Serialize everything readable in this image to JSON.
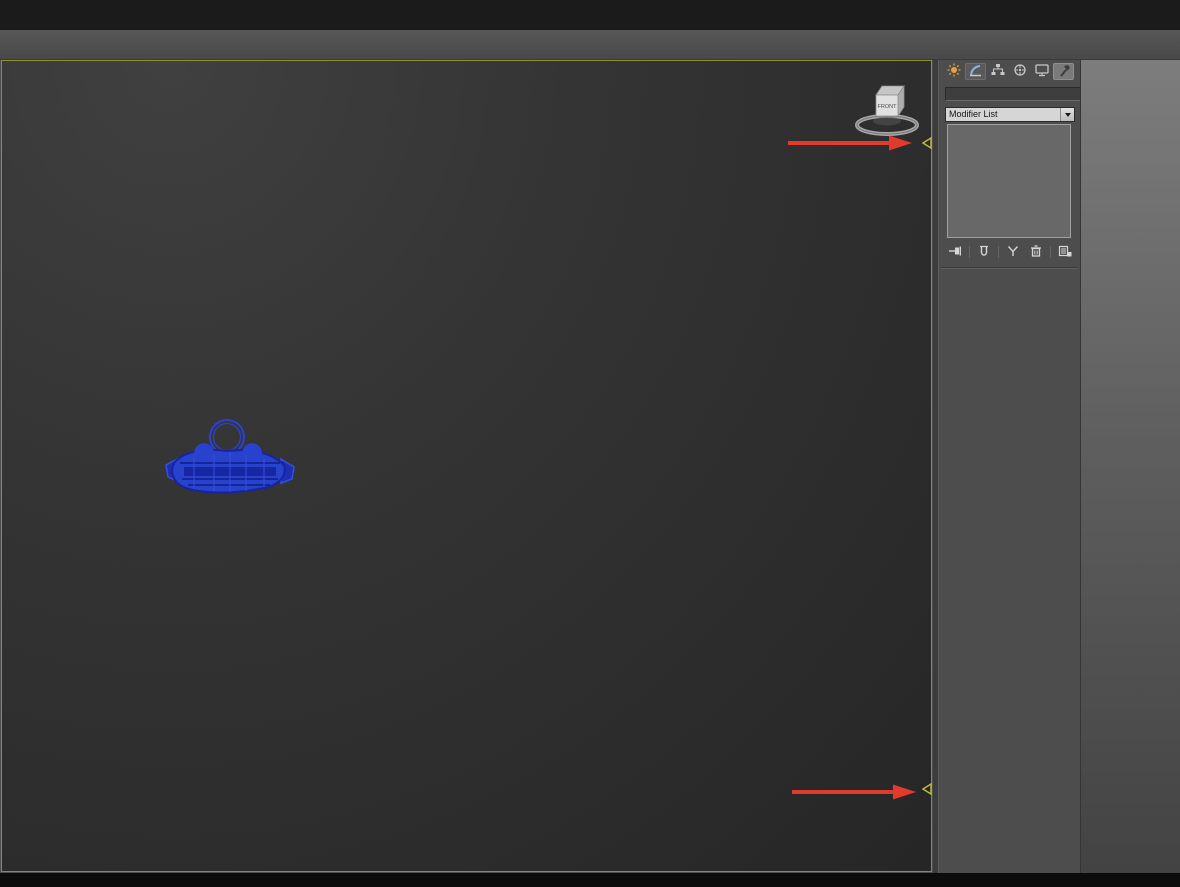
{
  "viewport": {
    "viewcube_label": "FRONT",
    "active_border_color": "#8f8f2f",
    "object_color": "#2742cc",
    "edge_marker_color": "#b9b93f"
  },
  "command_panel": {
    "tabs": [
      {
        "id": "create",
        "label": "Create"
      },
      {
        "id": "modify",
        "label": "Modify"
      },
      {
        "id": "hierarchy",
        "label": "Hierarchy"
      },
      {
        "id": "motion",
        "label": "Motion"
      },
      {
        "id": "display",
        "label": "Display"
      },
      {
        "id": "utilities",
        "label": "Utilities"
      }
    ],
    "object_name_field": {
      "value": ""
    },
    "object_color_swatch": "#ffffff",
    "modifier_dropdown": {
      "label": "Modifier List"
    },
    "modifier_stack": {
      "items": []
    },
    "stack_toolbar": [
      {
        "id": "pin-stack",
        "label": "Pin Stack"
      },
      {
        "id": "show-end-result",
        "label": "Show End Result"
      },
      {
        "id": "make-unique",
        "label": "Make Unique"
      },
      {
        "id": "remove-modifier",
        "label": "Remove Modifier from the Stack"
      },
      {
        "id": "configure-modifier-sets",
        "label": "Configure Modifier Sets"
      }
    ]
  },
  "annotations": {
    "arrow_color": "#e23b2e",
    "arrows": [
      {
        "id": "upper",
        "description": "Red arrow pointing at upper viewport edge marker"
      },
      {
        "id": "lower",
        "description": "Red arrow pointing at lower viewport edge marker"
      }
    ]
  }
}
